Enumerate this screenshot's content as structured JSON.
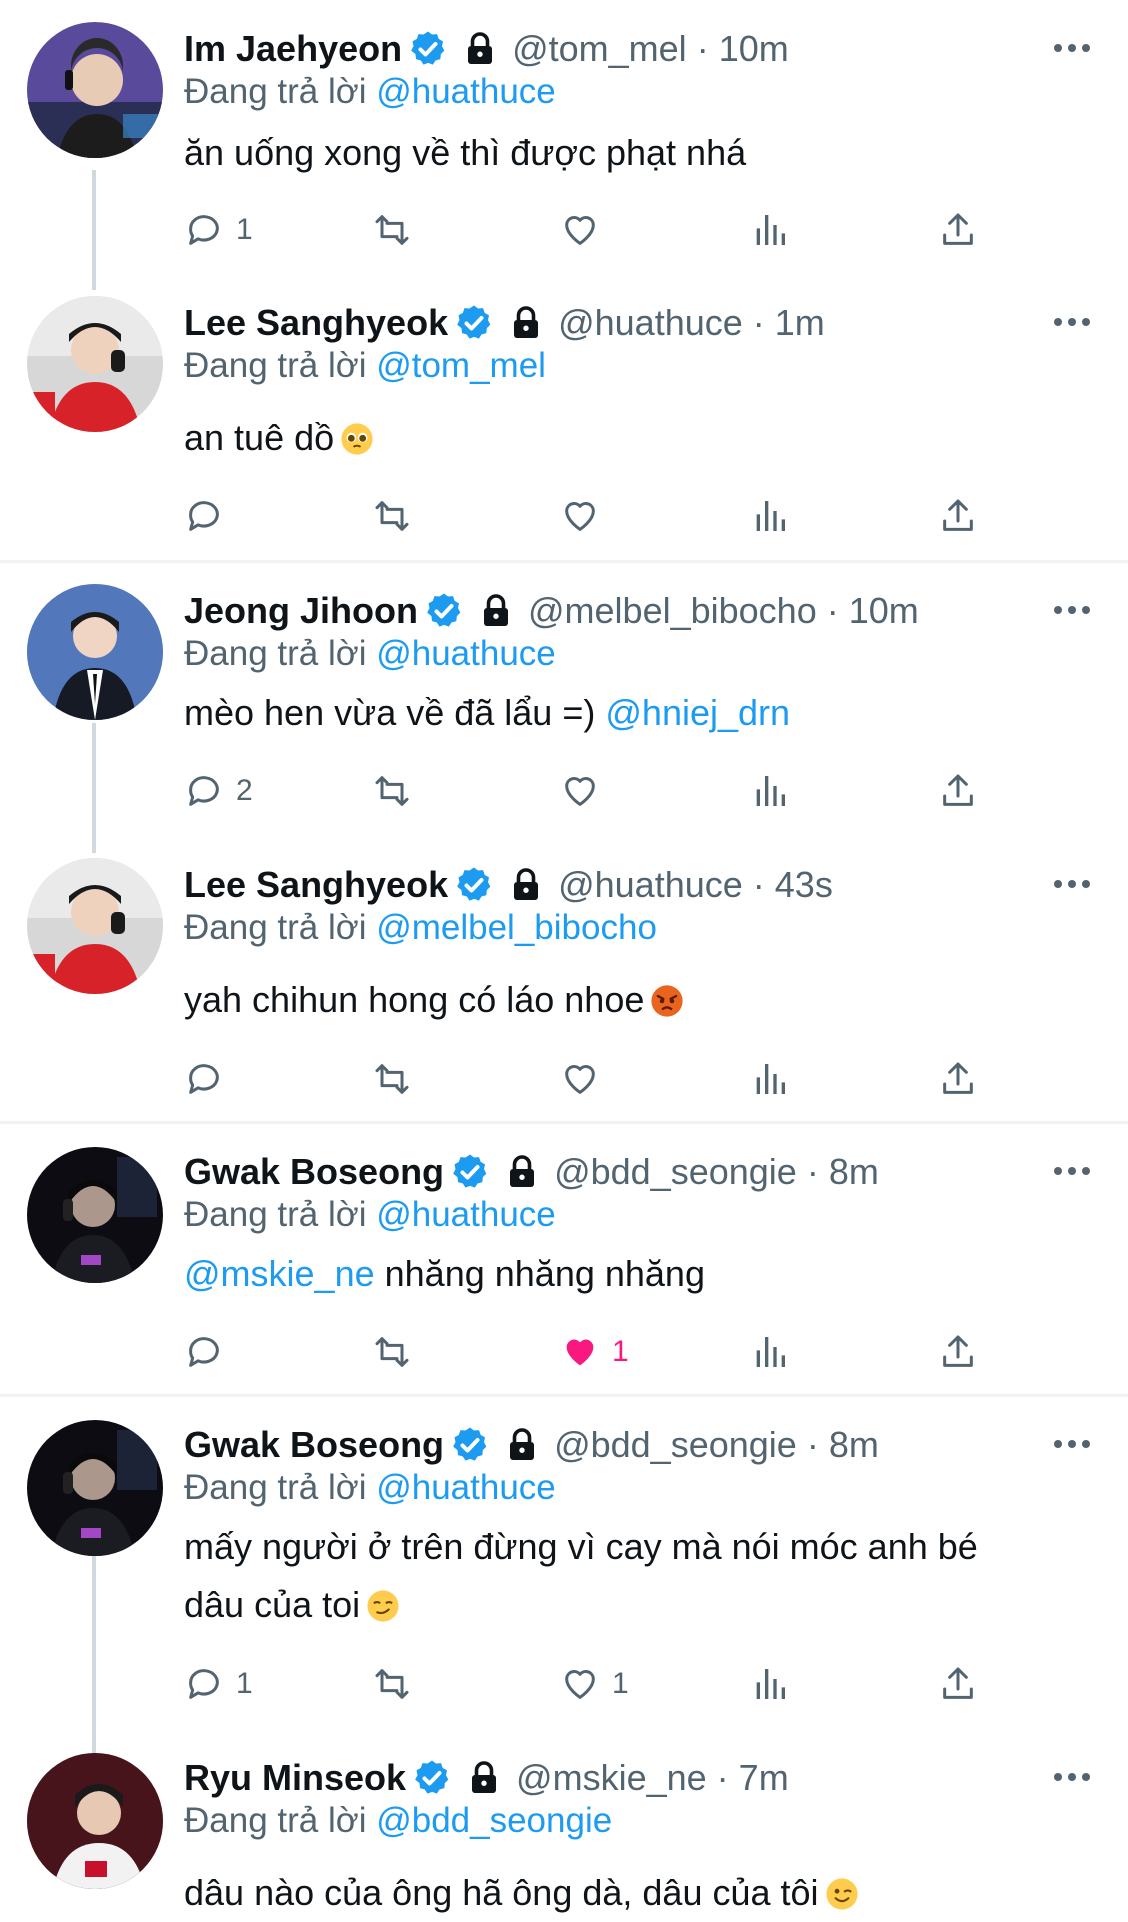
{
  "reply_prefix": "Đang trả lời",
  "tweets": [
    {
      "name": "Im Jaehyeon",
      "handle": "@tom_mel",
      "time": "10m",
      "reply_to": "@huathuce",
      "text": "ăn uống xong về thì được phạt nhá",
      "reply_count": "1",
      "like_count": "",
      "liked": false
    },
    {
      "name": "Lee Sanghyeok",
      "handle": "@huathuce",
      "time": "1m",
      "reply_to": "@tom_mel",
      "text": "an tuê dồ",
      "emoji": "pleading-face",
      "reply_count": "",
      "like_count": "",
      "liked": false
    },
    {
      "name": "Jeong Jihoon",
      "handle": "@melbel_bibocho",
      "time": "10m",
      "reply_to": "@huathuce",
      "text": "mèo hen vừa về đã lẩu =)",
      "trailing_mention": "@hniej_drn",
      "reply_count": "2",
      "like_count": "",
      "liked": false
    },
    {
      "name": "Lee Sanghyeok",
      "handle": "@huathuce",
      "time": "43s",
      "reply_to": "@melbel_bibocho",
      "text": "yah chihun hong có láo nhoe",
      "emoji": "angry-face",
      "reply_count": "",
      "like_count": "",
      "liked": false
    },
    {
      "name": "Gwak Boseong",
      "handle": "@bdd_seongie",
      "time": "8m",
      "reply_to": "@huathuce",
      "leading_mention": "@mskie_ne",
      "text": "nhăng nhăng nhăng",
      "reply_count": "",
      "like_count": "1",
      "liked": true
    },
    {
      "name": "Gwak Boseong",
      "handle": "@bdd_seongie",
      "time": "8m",
      "reply_to": "@huathuce",
      "text_lines": [
        "mấy người ở trên đừng vì cay mà nói móc anh bé",
        "dâu của toi"
      ],
      "emoji": "smirking-face",
      "reply_count": "1",
      "like_count": "1",
      "liked": false
    },
    {
      "name": "Ryu Minseok",
      "handle": "@mskie_ne",
      "time": "7m",
      "reply_to": "@bdd_seongie",
      "text": "dâu nào của ông hã ông dà, dâu của tôi",
      "emoji": "winking-face",
      "reply_count": "",
      "like_count": "",
      "liked": false
    }
  ],
  "colors": {
    "link": "#1d9bf0",
    "muted": "#536471",
    "text": "#0f1419",
    "liked": "#f91880",
    "verified": "#1d9bf0"
  }
}
